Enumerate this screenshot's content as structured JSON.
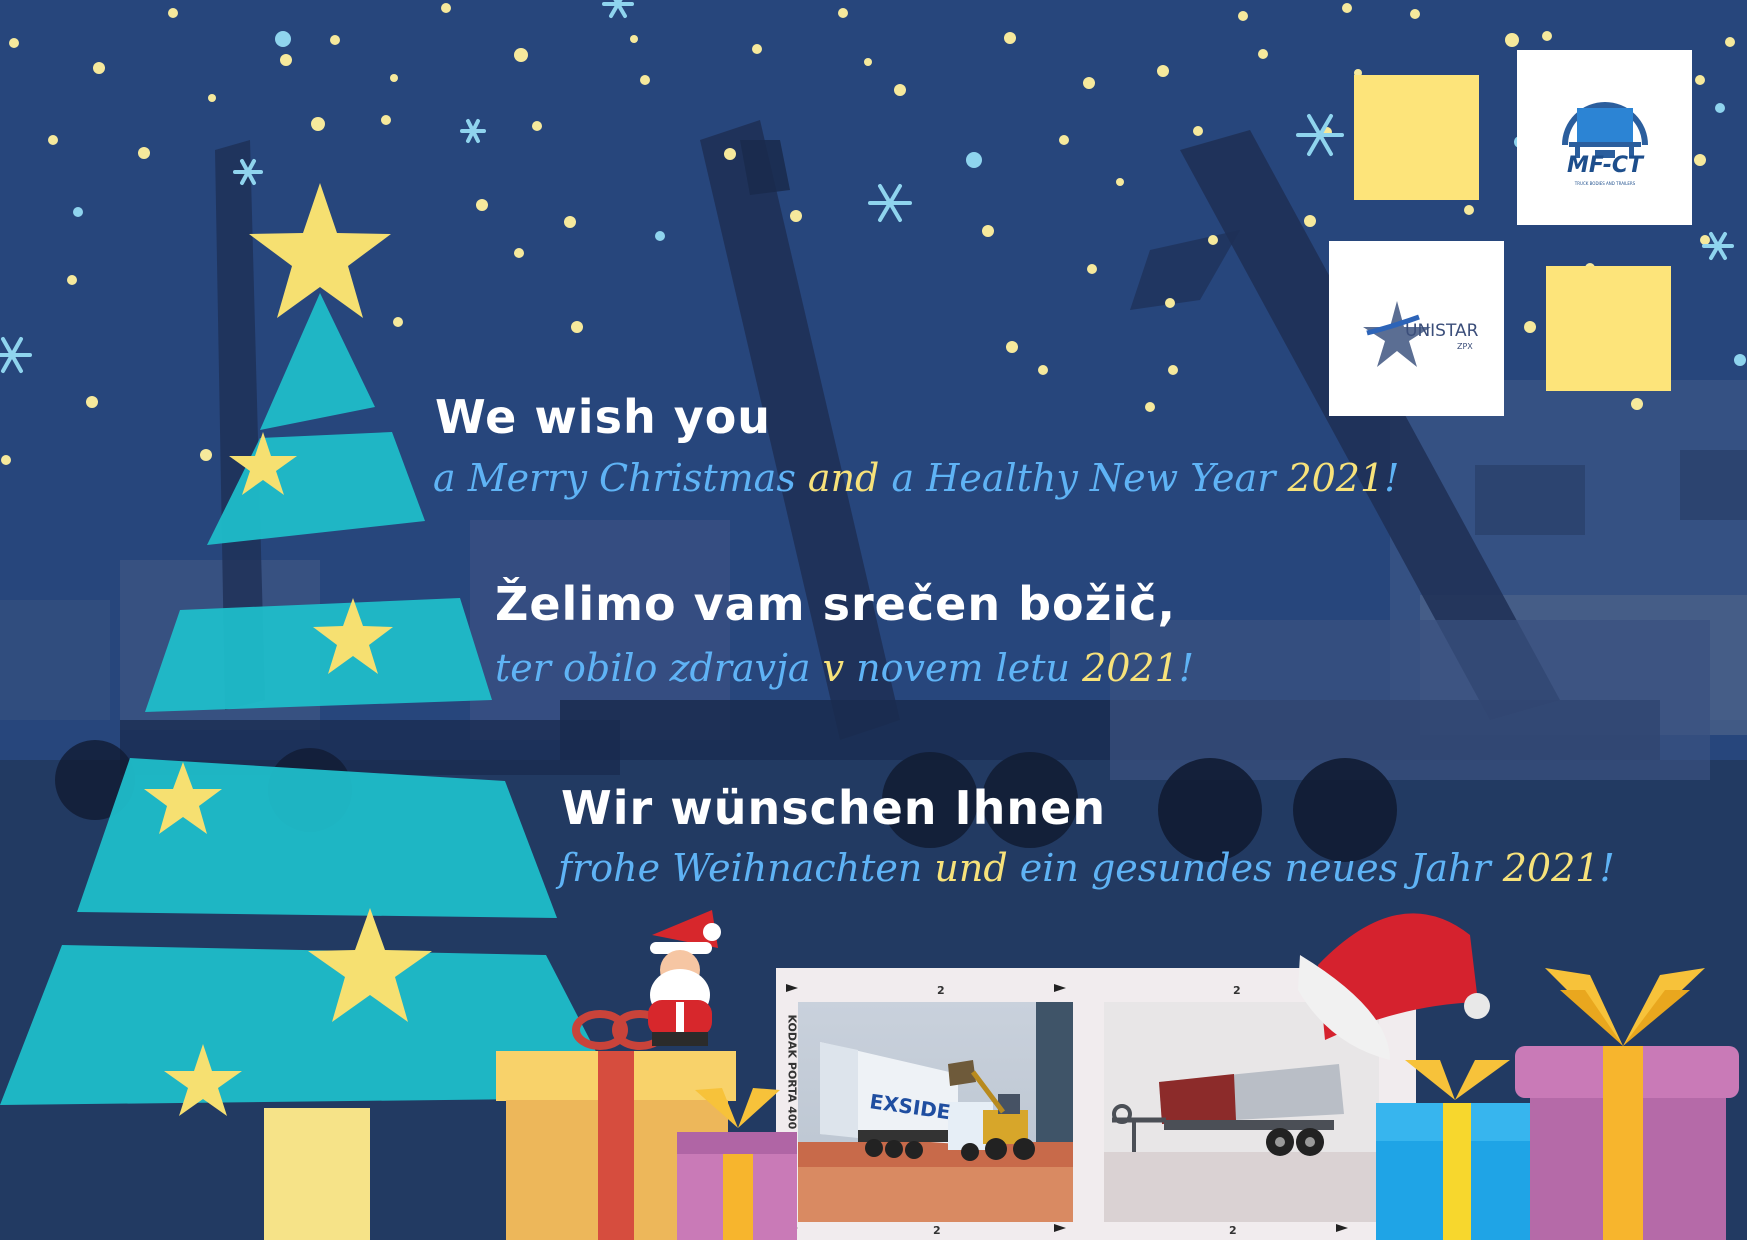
{
  "greetings": {
    "english": {
      "title": "We wish you",
      "line": [
        "a Merry Christmas ",
        "and",
        " a Healthy New Year ",
        "2021",
        "!"
      ]
    },
    "slovenian": {
      "title": "Želimo vam srečen božič,",
      "line": [
        "ter obilo zdravja ",
        "v",
        " novem letu ",
        "2021",
        "!"
      ]
    },
    "german": {
      "title": "Wir wünschen Ihnen",
      "line": [
        "frohe Weihnachten ",
        "und",
        " ein gesundes neues Jahr ",
        "2021",
        "!"
      ]
    }
  },
  "logos": {
    "mfct": {
      "name": "MF-CT",
      "tagline": "TRUCK BODIES AND TRAILERS"
    },
    "unistar": {
      "name": "UNISTAR",
      "sub": "ZPX"
    }
  },
  "photos": {
    "film_brand": "KODAK PORTA 400",
    "frame_number": "2",
    "truck_brand": "EXSIDE"
  },
  "colors": {
    "background": "#27467c",
    "tree": "#1fbdc9",
    "star": "#f6e071",
    "title_text": "#ffffff",
    "line_text": "#5fb3f5",
    "highlight_text": "#f7e27a"
  }
}
